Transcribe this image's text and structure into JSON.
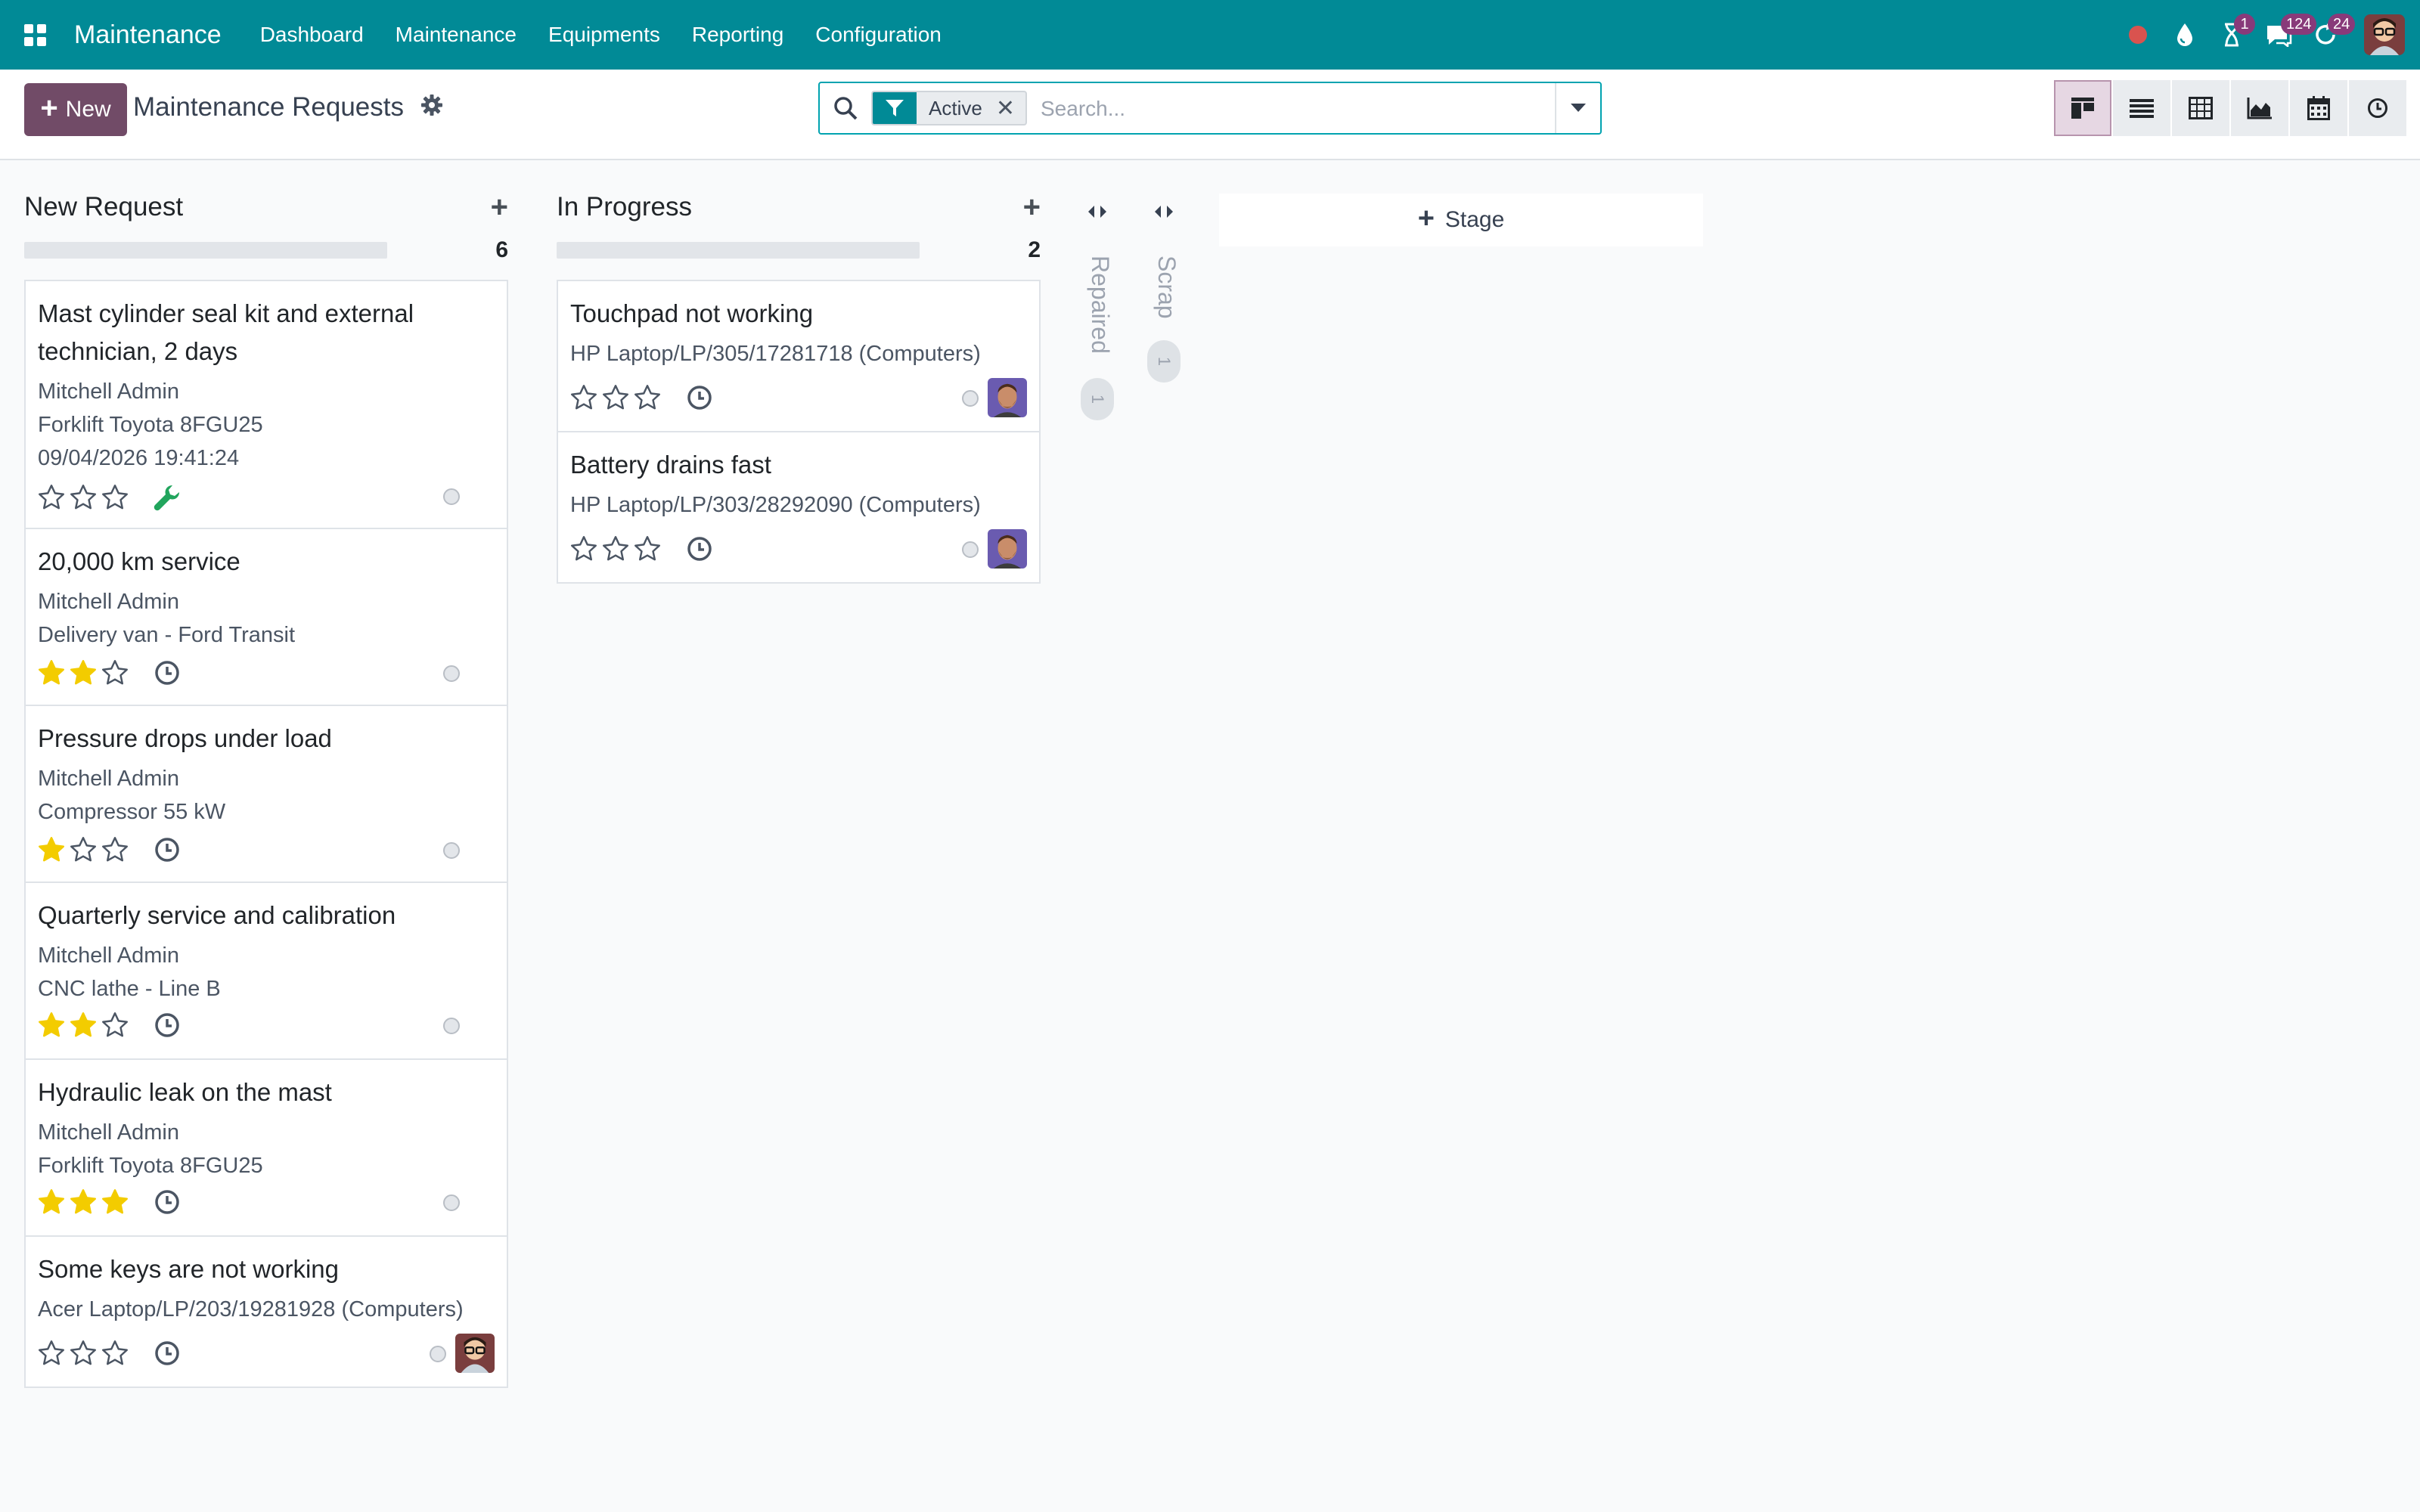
{
  "navbar": {
    "app_name": "Maintenance",
    "menu": [
      "Dashboard",
      "Maintenance",
      "Equipments",
      "Reporting",
      "Configuration"
    ],
    "badges": {
      "activities": "1",
      "messages": "124",
      "updates": "24"
    },
    "icons": [
      "record-icon",
      "drop-icon",
      "hourglass-icon",
      "chat-icon",
      "refresh-icon",
      "user-avatar"
    ]
  },
  "control": {
    "new_label": "New",
    "title": "Maintenance Requests",
    "facet_label": "Active",
    "search_placeholder": "Search...",
    "views": [
      "kanban",
      "list",
      "pivot",
      "graph",
      "calendar",
      "activity"
    ],
    "active_view": "kanban"
  },
  "columns": [
    {
      "title": "New Request",
      "count": "6",
      "cards": [
        {
          "title": "Mast cylinder seal kit and external technician, 2 days",
          "lines": [
            "Mitchell Admin",
            "Forklift Toyota 8FGU25",
            "09/04/2026 19:41:24"
          ],
          "stars": 0,
          "icon": "wrench"
        },
        {
          "title": "20,000 km service",
          "lines": [
            "Mitchell Admin",
            "Delivery van - Ford Transit"
          ],
          "stars": 2,
          "icon": "clock"
        },
        {
          "title": "Pressure drops under load",
          "lines": [
            "Mitchell Admin",
            "Compressor 55 kW"
          ],
          "stars": 1,
          "icon": "clock"
        },
        {
          "title": "Quarterly service and calibration",
          "lines": [
            "Mitchell Admin",
            "CNC lathe - Line B"
          ],
          "stars": 2,
          "icon": "clock"
        },
        {
          "title": "Hydraulic leak on the mast",
          "lines": [
            "Mitchell Admin",
            "Forklift Toyota 8FGU25"
          ],
          "stars": 3,
          "icon": "clock"
        },
        {
          "title": "Some keys are not working",
          "lines": [
            "Acer Laptop/LP/203/19281928 (Computers)"
          ],
          "stars": 0,
          "icon": "clock",
          "avatar": "admin"
        }
      ]
    },
    {
      "title": "In Progress",
      "count": "2",
      "cards": [
        {
          "title": "Touchpad not working",
          "lines": [
            "HP Laptop/LP/305/17281718 (Computers)"
          ],
          "stars": 0,
          "icon": "clock",
          "avatar": "tech"
        },
        {
          "title": "Battery drains fast",
          "lines": [
            "HP Laptop/LP/303/28292090 (Computers)"
          ],
          "stars": 0,
          "icon": "clock",
          "avatar": "tech"
        }
      ]
    }
  ],
  "folded_columns": [
    {
      "title": "Repaired",
      "count": "1"
    },
    {
      "title": "Scrap",
      "count": "1"
    }
  ],
  "add_stage_label": "Stage",
  "colors": {
    "navbar": "#018a96",
    "primary": "#714b67",
    "star": "#f3cc00",
    "wrench": "#21a55d",
    "badge": "#883a7a"
  }
}
